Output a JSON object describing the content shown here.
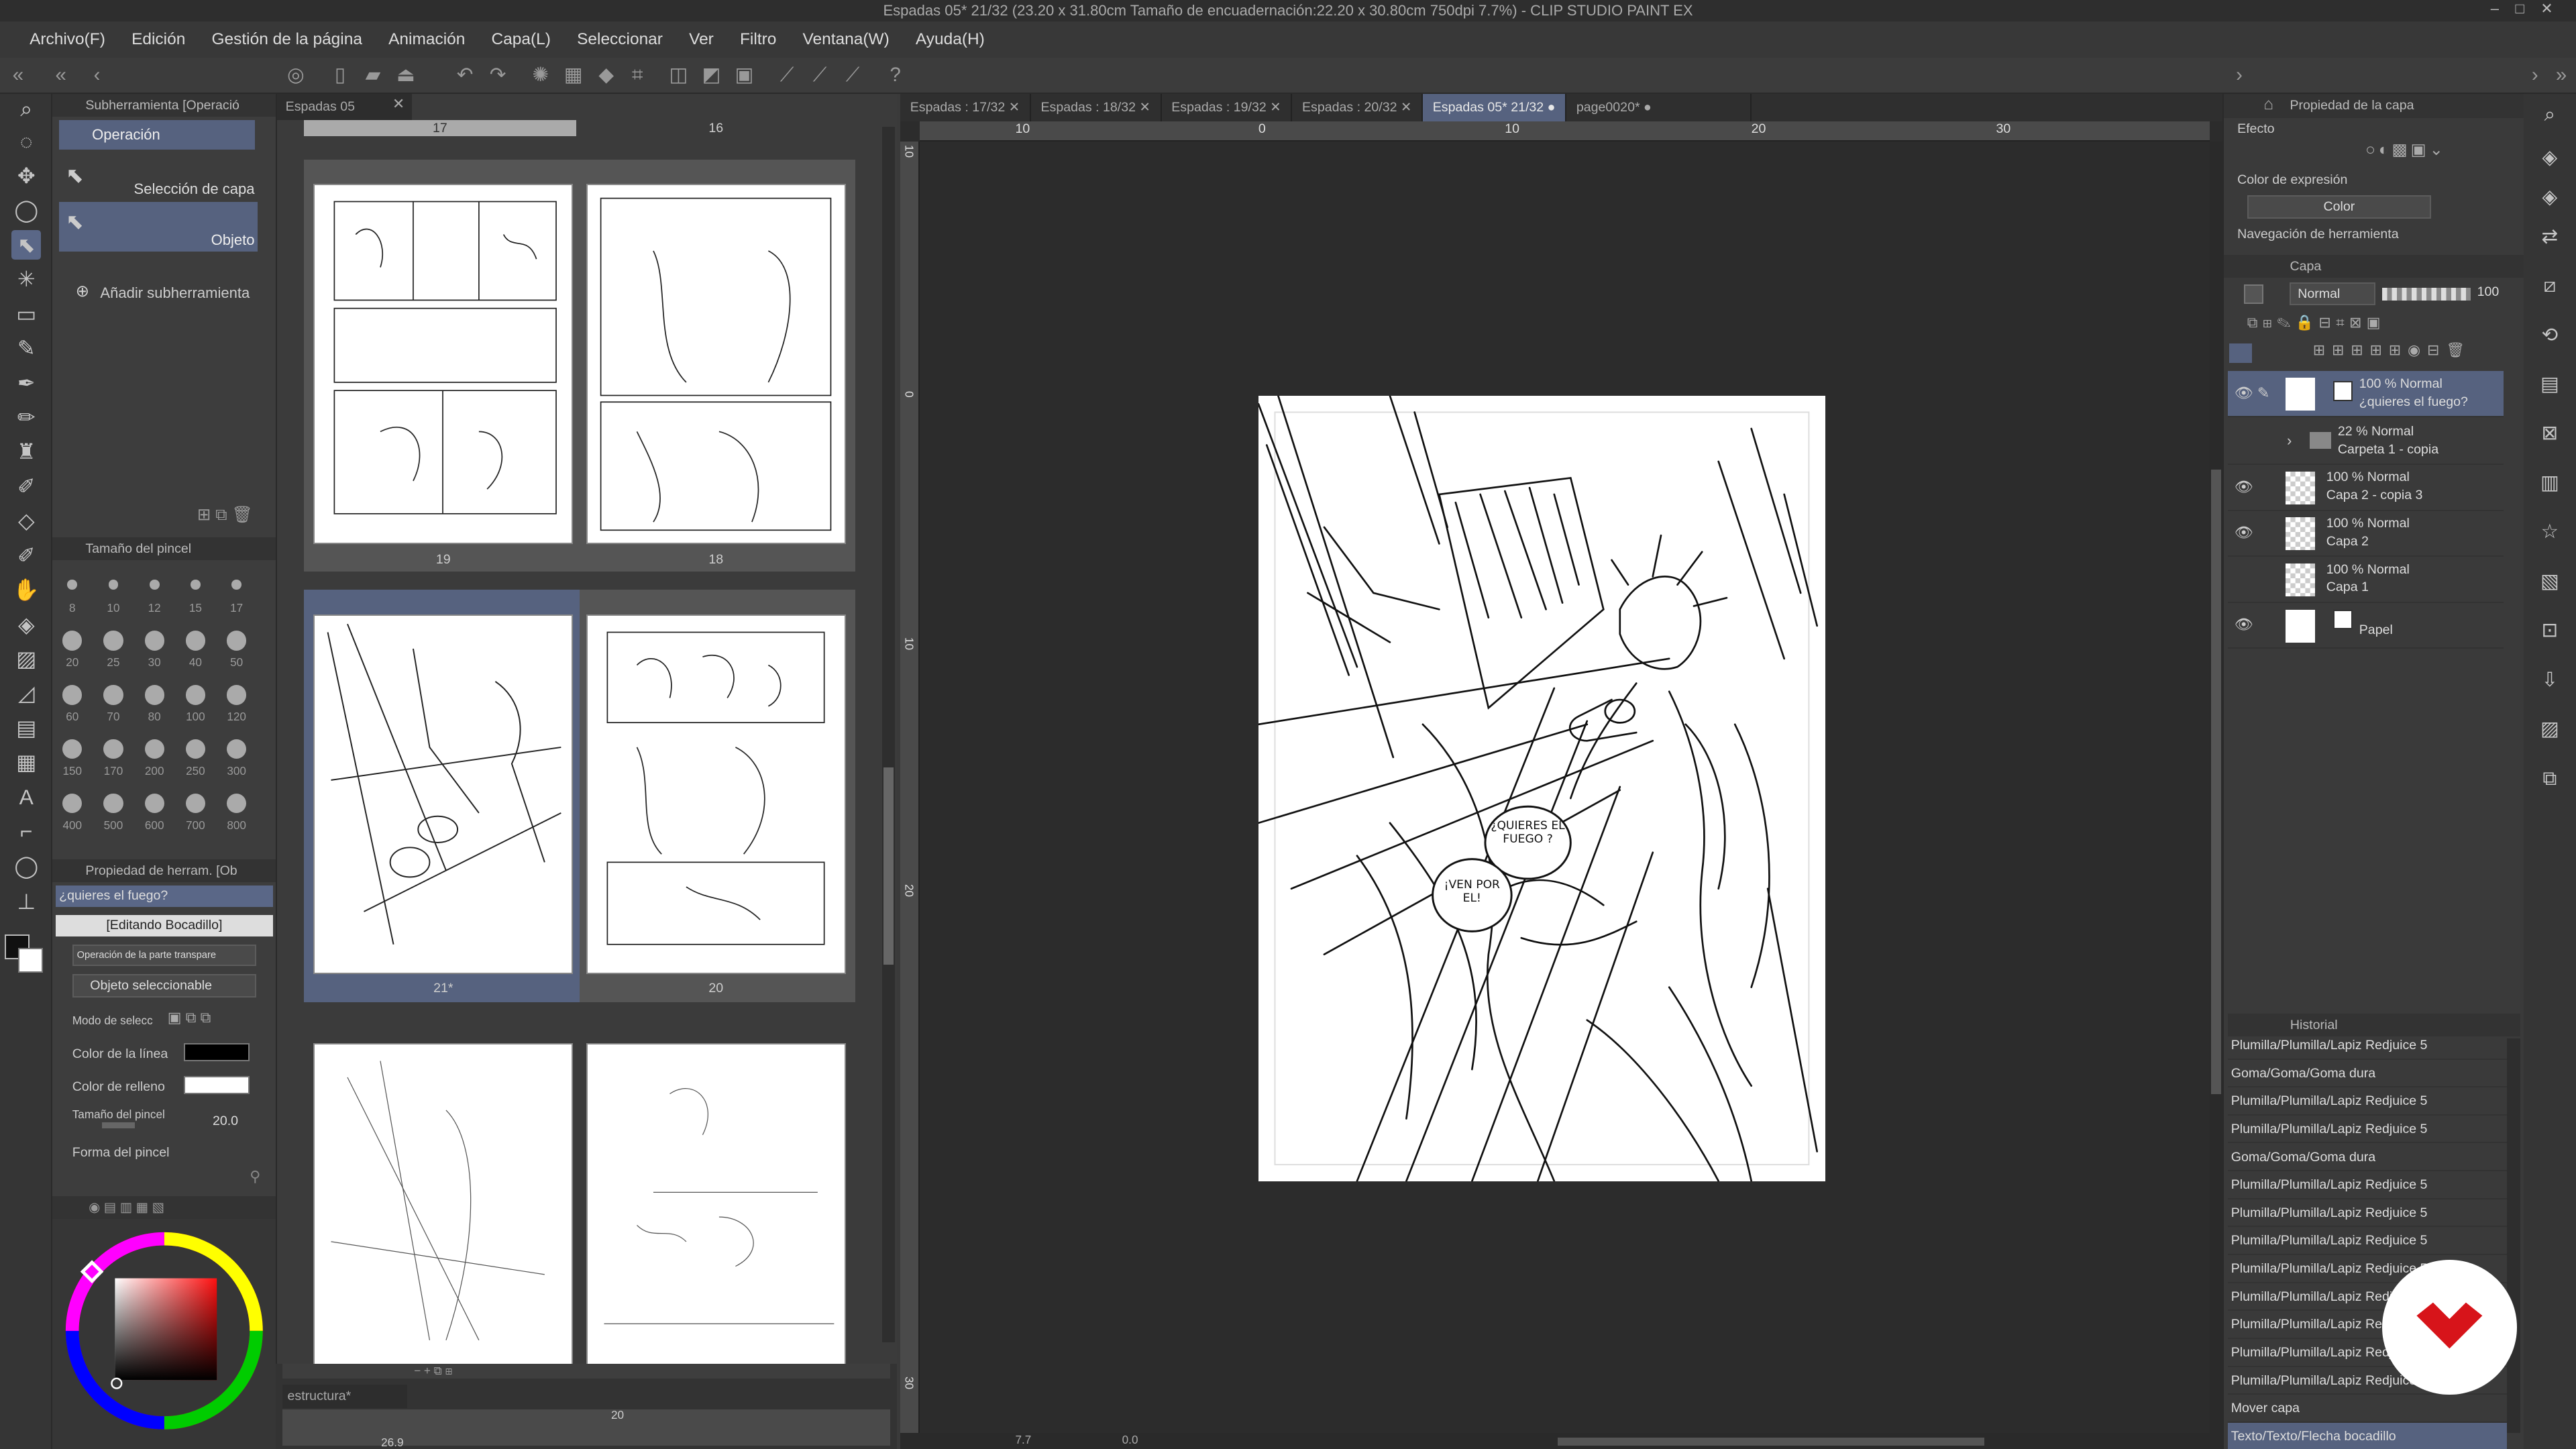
{
  "title": "Espadas 05* 21/32 (23.20 x 31.80cm Tamaño de encuadernación:22.20 x 30.80cm 750dpi 7.7%) - CLIP STUDIO PAINT EX",
  "menu": [
    "Archivo(F)",
    "Edición",
    "Gestión de la página",
    "Animación",
    "Capa(L)",
    "Seleccionar",
    "Ver",
    "Filtro",
    "Ventana(W)",
    "Ayuda(H)"
  ],
  "subtool": {
    "header": "Subherramienta [Operació",
    "operation": "Operación",
    "layer_selection": "Selección de capa",
    "object": "Objeto",
    "add": "Añadir subherramienta"
  },
  "brushsize": {
    "header": "Tamaño del pincel",
    "sizes": [
      "8",
      "10",
      "12",
      "15",
      "17",
      "20",
      "25",
      "30",
      "40",
      "50",
      "60",
      "70",
      "80",
      "100",
      "120",
      "150",
      "170",
      "200",
      "250",
      "300",
      "400",
      "500",
      "600",
      "700",
      "800"
    ]
  },
  "toolprop": {
    "header": "Propiedad de herram. [Ob",
    "subject": "¿quieres  el fuego?",
    "editing": "[Editando Bocadillo]",
    "transparent_op": "Operación de la parte transpare",
    "selectable": "Objeto seleccionable",
    "select_mode": "Modo de selecc",
    "line_color": "Color de la línea",
    "fill_color": "Color de relleno",
    "brush_size": "Tamaño del pincel",
    "brush_size_val": "20.0",
    "brush_shape": "Forma del pincel"
  },
  "pagemgr": {
    "tab": "Espadas 05",
    "pages": [
      {
        "label": "17"
      },
      {
        "label": "16"
      },
      {
        "label": "19"
      },
      {
        "label": "18"
      },
      {
        "label": "21*"
      },
      {
        "label": "20"
      }
    ]
  },
  "timeline": {
    "tab": "estructura*",
    "zoom": "26.9",
    "frame": "20"
  },
  "tabs": [
    "Espadas : 17/32",
    "Espadas : 18/32",
    "Espadas : 19/32",
    "Espadas : 20/32",
    "Espadas 05* 21/32",
    "page0020*"
  ],
  "ruler": {
    "h": [
      "10",
      "0",
      "10",
      "20",
      "30"
    ],
    "v": [
      "10",
      "0",
      "10",
      "20",
      "30"
    ]
  },
  "canvas": {
    "bubble1": "¿QUIERES EL FUEGO ?",
    "bubble2": "¡VEN POR EL!",
    "status_zoom": "7.7",
    "status_angle": "0.0"
  },
  "layerprop": {
    "header": "Propiedad de la capa",
    "effect": "Efecto",
    "expr_color": "Color de expresión",
    "expr_value": "Color",
    "toolnav": "Navegación de herramienta"
  },
  "layers": {
    "header": "Capa",
    "blend": "Normal",
    "opacity": "100",
    "items": [
      {
        "mode": "100 % Normal",
        "name": "¿quieres  el fuego?"
      },
      {
        "mode": "22 % Normal",
        "name": "Carpeta 1 - copia"
      },
      {
        "mode": "100 % Normal",
        "name": "Capa 2 - copia 3"
      },
      {
        "mode": "100 % Normal",
        "name": "Capa 2"
      },
      {
        "mode": "100 % Normal",
        "name": "Capa 1"
      },
      {
        "mode": "",
        "name": "Papel"
      }
    ]
  },
  "history": {
    "header": "Historial",
    "items": [
      "Plumilla/Plumilla/Lapiz Redjuice 5",
      "Goma/Goma/Goma dura",
      "Plumilla/Plumilla/Lapiz Redjuice 5",
      "Plumilla/Plumilla/Lapiz Redjuice 5",
      "Goma/Goma/Goma dura",
      "Plumilla/Plumilla/Lapiz Redjuice 5",
      "Plumilla/Plumilla/Lapiz Redjuice 5",
      "Plumilla/Plumilla/Lapiz Redjuice 5",
      "Plumilla/Plumilla/Lapiz Redjuice 5",
      "Plumilla/Plumilla/Lapiz Redjuice 5",
      "Plumilla/Plumilla/Lapiz Redjuice 5",
      "Plumilla/Plumilla/Lapiz Redjuice 5",
      "Plumilla/Plumilla/Lapiz Redjuice 5",
      "Mover capa",
      "Texto/Texto/Flecha bocadillo"
    ]
  },
  "colors": {
    "accent": "#56627f",
    "badge": "#d7141a"
  }
}
